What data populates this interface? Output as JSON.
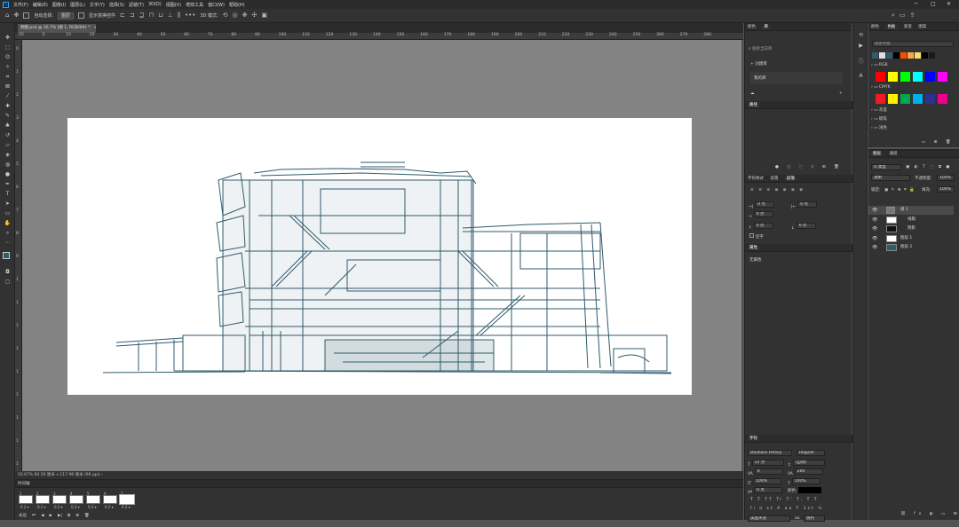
{
  "menubar": {
    "app_icon": "Ps",
    "items": [
      "文件(F)",
      "编辑(E)",
      "图像(I)",
      "图层(L)",
      "文字(Y)",
      "选择(S)",
      "滤镜(T)",
      "3D(D)",
      "视图(V)",
      "增效工具",
      "窗口(W)",
      "帮助(H)"
    ],
    "window_controls": {
      "minimize": "─",
      "maximize": "□",
      "close": "✕"
    }
  },
  "options": {
    "home_icon": "⌂",
    "move_icon": "✥",
    "auto_select_label": "自动选择:",
    "auto_select_value": "图层",
    "show_transform_label": "显示变换控件",
    "mode_3d_label": "3D 模式:",
    "more_label": "•••"
  },
  "document": {
    "tab_title": "侧图.psd @ 16.7% (图 1, RGB/8#) *",
    "tab_close": "×",
    "ruler_h_ticks": [
      "20",
      "0",
      "10",
      "20",
      "30",
      "40",
      "50",
      "60",
      "70",
      "80",
      "90",
      "100",
      "110",
      "120",
      "130",
      "140",
      "150",
      "160",
      "170",
      "180",
      "190",
      "200",
      "210",
      "220",
      "230",
      "240",
      "250",
      "260",
      "270",
      "280"
    ],
    "ruler_v_ticks": [
      "0",
      "1",
      "2",
      "3",
      "4",
      "5",
      "6",
      "7",
      "8",
      "9",
      "1",
      "1",
      "1",
      "1",
      "1",
      "1",
      "1",
      "1",
      "1"
    ],
    "status": "16.67%    84.56 厘米 x 117.98 厘米 (96 ppi)   ›",
    "building_color": "#2f5b6d"
  },
  "timeline": {
    "title": "时间轴",
    "frames": [
      {
        "num": "1",
        "dur": "0.2 ▾"
      },
      {
        "num": "2",
        "dur": "0.2 ▾"
      },
      {
        "num": "3",
        "dur": "0.2 ▾"
      },
      {
        "num": "4",
        "dur": "0.2 ▾"
      },
      {
        "num": "5",
        "dur": "0.2 ▾"
      },
      {
        "num": "6",
        "dur": "0.2 ▾"
      },
      {
        "num": "7",
        "dur": "0.2 ▾"
      }
    ],
    "loop_label": "永远",
    "controls": [
      "⏮",
      "◀",
      "▶",
      "▶|",
      "⧉",
      "⊞",
      "🗑"
    ]
  },
  "panels": {
    "libraries": {
      "tabs": [
        "颜色",
        "库"
      ],
      "search_placeholder": "搜索当前库",
      "new_library": "+ 创建库",
      "library_item": "我的库"
    },
    "paths": {
      "tab": "路径"
    },
    "paragraph": {
      "tabs": [
        "字符样式",
        "段落",
        "段落"
      ],
      "fields": [
        {
          "icon": "→|",
          "value": "0 点"
        },
        {
          "icon": "|←",
          "value": "0 点"
        },
        {
          "icon": "→",
          "value": "0 点"
        },
        {
          "icon": "↑",
          "value": "0 点"
        },
        {
          "icon": "↓",
          "value": "0 点"
        }
      ],
      "hyphenate_label": "连字"
    },
    "properties": {
      "tab": "属性",
      "no_properties": "无属性"
    },
    "character": {
      "tab": "字符",
      "font_family": "Bauhaus Heavy",
      "font_style": "Regular",
      "size": "12 点",
      "leading": "(自动)",
      "kerning": "0",
      "tracking": "200",
      "vscale": "100%",
      "hscale": "100%",
      "baseline": "0 点",
      "color_label": "颜色:",
      "type_buttons": [
        "T",
        "T",
        "TT",
        "Tr",
        "T'",
        "T,",
        "T",
        "T"
      ],
      "ot_buttons": [
        "fi",
        "σ",
        "st",
        "A",
        "aa",
        "T",
        "1st",
        "½"
      ],
      "language": "美国英语",
      "aa_label": "aa",
      "aa_value": "锐利"
    },
    "swatches": {
      "tabs": [
        "颜色",
        "色板",
        "渐变",
        "图案"
      ],
      "search_placeholder": "搜索色板",
      "recent_colors": [
        "#2f5b6d",
        "#e0e0e0",
        "#2f5b6d",
        "#000000",
        "#ff4d00",
        "#ffa64d",
        "#ffd966",
        "#000000",
        "#1a1a1a"
      ],
      "groups": [
        {
          "name": "RGB",
          "colors": [
            "#ff0000",
            "#ffff00",
            "#00ff00",
            "#00ffff",
            "#0000ff",
            "#ff00ff"
          ]
        },
        {
          "name": "CMYK",
          "colors": [
            "#ed1c24",
            "#fff200",
            "#00a651",
            "#00aeef",
            "#2e3192",
            "#ec008c"
          ]
        },
        {
          "name": "灰度",
          "colors": []
        },
        {
          "name": "蜡笔",
          "colors": []
        },
        {
          "name": "浅色",
          "colors": []
        }
      ]
    },
    "layers": {
      "tabs": [
        "图层",
        "通道"
      ],
      "filter_kind": "Q 类型",
      "blend_mode": "透明",
      "opacity_label": "不透明度:",
      "opacity_value": "100%",
      "lock_label": "锁定:",
      "fill_label": "填充:",
      "fill_value": "100%",
      "rows": [
        {
          "name": "组 1",
          "kind": "group"
        },
        {
          "name": "线稿",
          "kind": "layer"
        },
        {
          "name": "阴影",
          "kind": "layer"
        },
        {
          "name": "图层 1",
          "kind": "layer"
        },
        {
          "name": "图层 2",
          "kind": "layer"
        }
      ],
      "bottom_icons": [
        "⛓",
        "fx",
        "◐",
        "◑",
        "▭",
        "⊞",
        "🗑"
      ]
    }
  }
}
